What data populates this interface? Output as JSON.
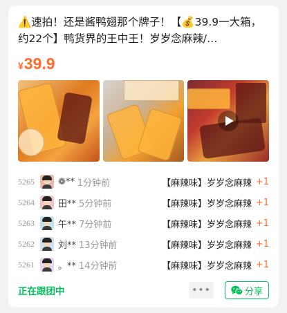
{
  "post": {
    "title": "⚠️速拍！还是酱鸭翅那个牌子！【💰39.9一大箱，约22个】鸭货界的王中王！岁岁念麻辣/…",
    "price_symbol": "¥",
    "price": "39.9"
  },
  "images": [
    {
      "name": "product-photo-1",
      "has_play": false
    },
    {
      "name": "product-photo-2",
      "has_play": false
    },
    {
      "name": "product-photo-3",
      "has_play": true
    }
  ],
  "orders": [
    {
      "num": "5265",
      "user": "❁**",
      "time": "1分钟前",
      "product": "【麻辣味】岁岁念麻辣",
      "qty": "+1",
      "avatar_color": "#e9b9b0"
    },
    {
      "num": "5264",
      "user": "田**",
      "time": "5分钟前",
      "product": "【麻辣味】岁岁念麻辣",
      "qty": "+1",
      "avatar_color": "#f4c3c8"
    },
    {
      "num": "5263",
      "user": "午**",
      "time": "7分钟前",
      "product": "【麻辣味】岁岁念麻辣",
      "qty": "+1",
      "avatar_color": "#bfe3e8"
    },
    {
      "num": "5262",
      "user": "刘**",
      "time": "13分钟前",
      "product": "【麻辣味】岁岁念麻辣",
      "qty": "+1",
      "avatar_color": "#cfe1f1"
    },
    {
      "num": "5261",
      "user": "。**",
      "time": "14分钟前",
      "product": "【麻辣味】岁岁念麻辣",
      "qty": "+1",
      "avatar_color": "#e3d7f0"
    }
  ],
  "footer": {
    "status": "正在跟团中",
    "more": "•••",
    "share": "分享"
  },
  "colors": {
    "accent_orange": "#ff6a2b",
    "wechat_green": "#07c160"
  }
}
